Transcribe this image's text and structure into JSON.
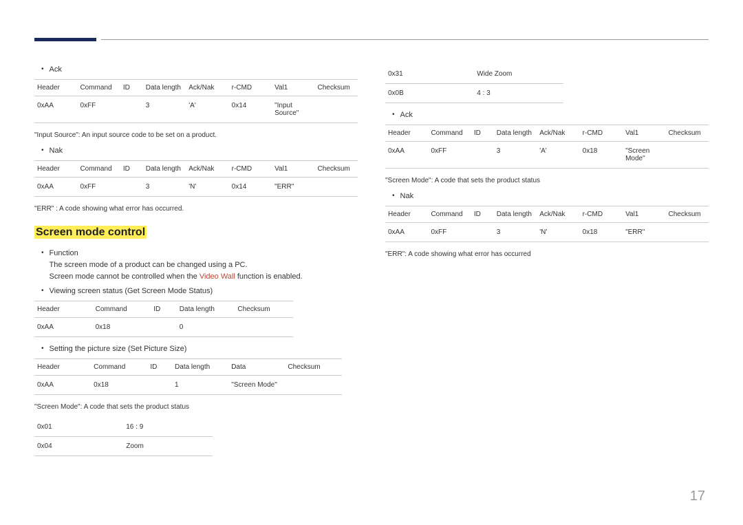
{
  "left": {
    "b_ack": "Ack",
    "ack_headers": [
      "Header",
      "Command",
      "ID",
      "Data length",
      "Ack/Nak",
      "r-CMD",
      "Val1",
      "Checksum"
    ],
    "ack_row": [
      "0xAA",
      "0xFF",
      "",
      "3",
      "'A'",
      "0x14",
      "\"Input Source\"",
      ""
    ],
    "p_input_source": "\"Input Source\": An input source code to be set on a product.",
    "b_nak": "Nak",
    "nak_headers": [
      "Header",
      "Command",
      "ID",
      "Data length",
      "Ack/Nak",
      "r-CMD",
      "Val1",
      "Checksum"
    ],
    "nak_row": [
      "0xAA",
      "0xFF",
      "",
      "3",
      "'N'",
      "0x14",
      "\"ERR\"",
      ""
    ],
    "p_err": "\"ERR\" : A code showing what error has occurred.",
    "section_title": "Screen mode control",
    "b_function": "Function",
    "fn_line1": "The screen mode of a product can be changed using a PC.",
    "fn_line2a": "Screen mode cannot be controlled when the ",
    "fn_line2b": "Video Wall",
    "fn_line2c": " function is enabled.",
    "b_viewing": "Viewing screen status (Get Screen Mode Status)",
    "view_headers": [
      "Header",
      "Command",
      "ID",
      "Data length",
      "Checksum"
    ],
    "view_row": [
      "0xAA",
      "0x18",
      "",
      "0",
      ""
    ],
    "b_setting": "Setting the picture size (Set Picture Size)",
    "set_headers": [
      "Header",
      "Command",
      "ID",
      "Data length",
      "Data",
      "Checksum"
    ],
    "set_row": [
      "0xAA",
      "0x18",
      "",
      "1",
      "\"Screen Mode\"",
      ""
    ],
    "p_screen_mode": "\"Screen Mode\": A code that sets the product status",
    "codes": [
      {
        "c": "0x01",
        "v": "16 : 9"
      },
      {
        "c": "0x04",
        "v": "Zoom"
      }
    ]
  },
  "right": {
    "codes": [
      {
        "c": "0x31",
        "v": "Wide Zoom"
      },
      {
        "c": "0x0B",
        "v": "4 : 3"
      }
    ],
    "b_ack": "Ack",
    "ack_headers": [
      "Header",
      "Command",
      "ID",
      "Data length",
      "Ack/Nak",
      "r-CMD",
      "Val1",
      "Checksum"
    ],
    "ack_row": [
      "0xAA",
      "0xFF",
      "",
      "3",
      "'A'",
      "0x18",
      "\"Screen Mode\"",
      ""
    ],
    "p_screen_mode": "\"Screen Mode\": A code that sets the product status",
    "b_nak": "Nak",
    "nak_headers": [
      "Header",
      "Command",
      "ID",
      "Data length",
      "Ack/Nak",
      "r-CMD",
      "Val1",
      "Checksum"
    ],
    "nak_row": [
      "0xAA",
      "0xFF",
      "",
      "3",
      "'N'",
      "0x18",
      "\"ERR\"",
      ""
    ],
    "p_err": "\"ERR\": A code showing what error has occurred"
  },
  "page_num": "17"
}
